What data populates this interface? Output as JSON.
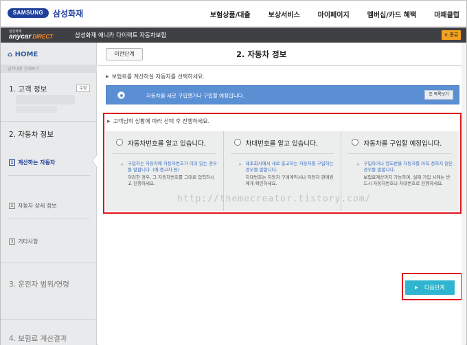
{
  "header": {
    "brand_pill": "SAMSUNG",
    "brand_name": "삼성화재",
    "nav": [
      "보험상품/대출",
      "보상서비스",
      "마이페이지",
      "멤버십/카드 혜택",
      "마패클럽"
    ]
  },
  "subheader": {
    "small_label": "삼성화재",
    "brand": "anycar",
    "brand_tag": "DIRECT",
    "service_title": "삼성화재 애니카 다이렉트 자동차보험",
    "close_label": "✕ 종료"
  },
  "sidebar": {
    "home_label": "HOME",
    "sub_caption": "입력내용 전체보기",
    "steps": [
      {
        "label": "1. 고객 정보",
        "edit": "수정"
      },
      {
        "label": "2. 자동차 정보"
      },
      {
        "label": "3. 운전자 범위/연령"
      },
      {
        "label": "4. 보험료 계산결과"
      }
    ],
    "substeps": [
      {
        "num": "1",
        "label": "계산하는 자동차"
      },
      {
        "num": "2",
        "label": "자동차 상세 정보"
      },
      {
        "num": "3",
        "label": "기타사항"
      }
    ]
  },
  "main": {
    "back_label": "이전단계",
    "title": "2. 자동차 정보",
    "instruction1": "보험료를 계산하실 자동차를 선택하세요.",
    "selected_option": "자동차를 새로 구입했거나 구입할 예정입니다.",
    "list_button": "목록보기",
    "instruction2": "고객님의 상황에 따라 선택 후 진행하세요.",
    "options": [
      {
        "label": "자동차번호를 알고 있습니다.",
        "desc_blue": "구입하는 자동차에 자동차번호가 이미 있는 경우를 말합니다. (예:중고차 등)",
        "desc_gray": "이러한 경우, 그 자동차번호를 그대로 입력하시고 진행하세요."
      },
      {
        "label": "차대번호를 알고 있습니다.",
        "desc_blue": "제조회사에서 새로 출고하는 자동차를 구입하는 경우를 말합니다.",
        "desc_gray": "차대번호는 자동차 구매계약서나 자동차 판매원에게 확인하세요."
      },
      {
        "label": "자동차를 구입할 예정입니다.",
        "desc_blue": "구입하거나 양도받을 자동차를 아직 정하지 않은 경우를 말합니다.",
        "desc_gray": "보험료계산까지 가능하며, 실제 가입 시에는 반드시 자동차번호나 차대번호로 진행하세요."
      }
    ],
    "watermark": "http://themecreator.tistory.com/",
    "next_label": "다음단계"
  }
}
